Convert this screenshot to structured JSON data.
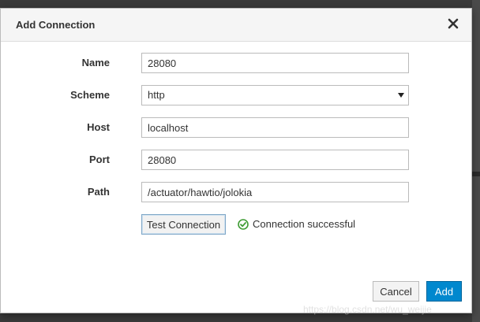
{
  "dialog": {
    "title": "Add Connection",
    "close_icon": "close-icon"
  },
  "form": {
    "name": {
      "label": "Name",
      "value": "28080"
    },
    "scheme": {
      "label": "Scheme",
      "value": "http"
    },
    "host": {
      "label": "Host",
      "value": "localhost"
    },
    "port": {
      "label": "Port",
      "value": "28080"
    },
    "path": {
      "label": "Path",
      "value": "/actuator/hawtio/jolokia"
    }
  },
  "test": {
    "button_label": "Test Connection",
    "status_text": "Connection successful",
    "status_icon": "check-circle-icon",
    "status_color": "#3f9c35"
  },
  "footer": {
    "cancel_label": "Cancel",
    "add_label": "Add",
    "primary_color": "#0088ce"
  },
  "watermark": "https://blog.csdn.net/wu_weijie"
}
